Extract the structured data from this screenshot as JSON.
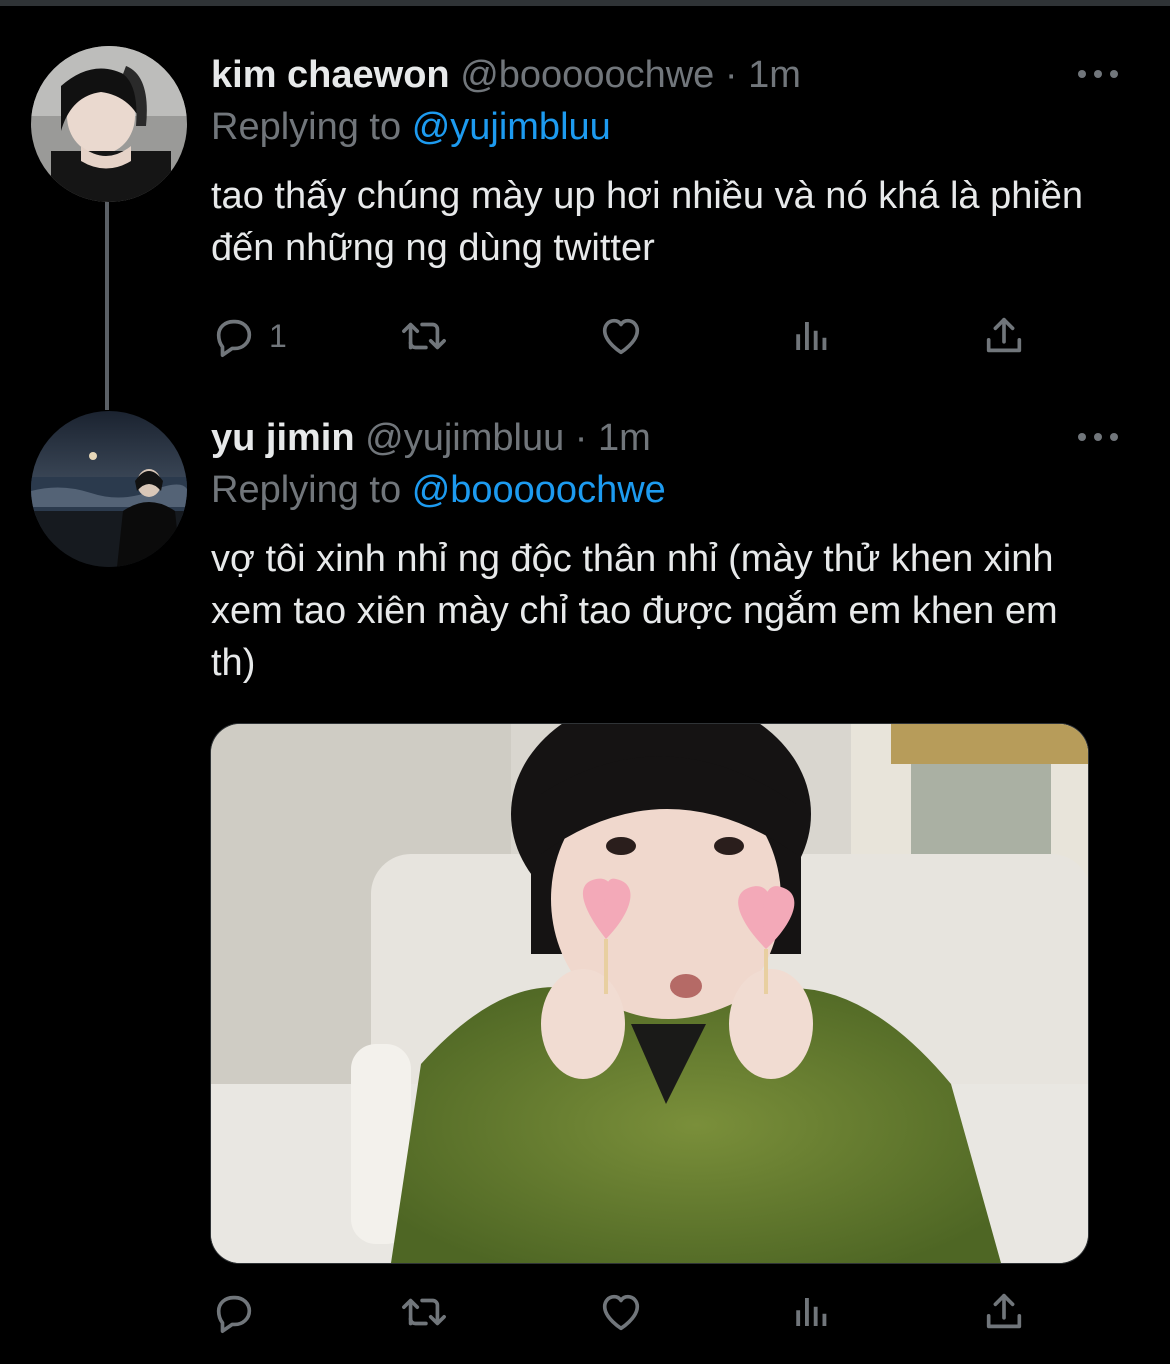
{
  "tweets": [
    {
      "display_name": "kim chaewon",
      "handle": "@booooochwe",
      "separator": "·",
      "time": "1m",
      "replying_prefix": "Replying to",
      "replying_to": "@yujimbluu",
      "text": "tao thấy chúng mày up hơi nhiều và nó khá là phiền đến những ng dùng twitter",
      "reply_count": "1"
    },
    {
      "display_name": "yu jimin",
      "handle": "@yujimbluu",
      "separator": "·",
      "time": "1m",
      "replying_prefix": "Replying to",
      "replying_to": "@booooochwe",
      "text": "vợ tôi xinh nhỉ ng độc thân nhỉ (mày thử khen xinh xem tao xiên mày chỉ tao được ngắm em khen em th)",
      "reply_count": ""
    }
  ],
  "icons": {
    "more": "more-horizontal-icon",
    "reply": "reply-icon",
    "retweet": "retweet-icon",
    "like": "like-icon",
    "views": "views-icon",
    "share": "share-icon"
  },
  "colors": {
    "background": "#000000",
    "text": "#e7e9ea",
    "muted": "#71767b",
    "accent": "#1d9bf0",
    "thread_line": "#5b6066"
  }
}
